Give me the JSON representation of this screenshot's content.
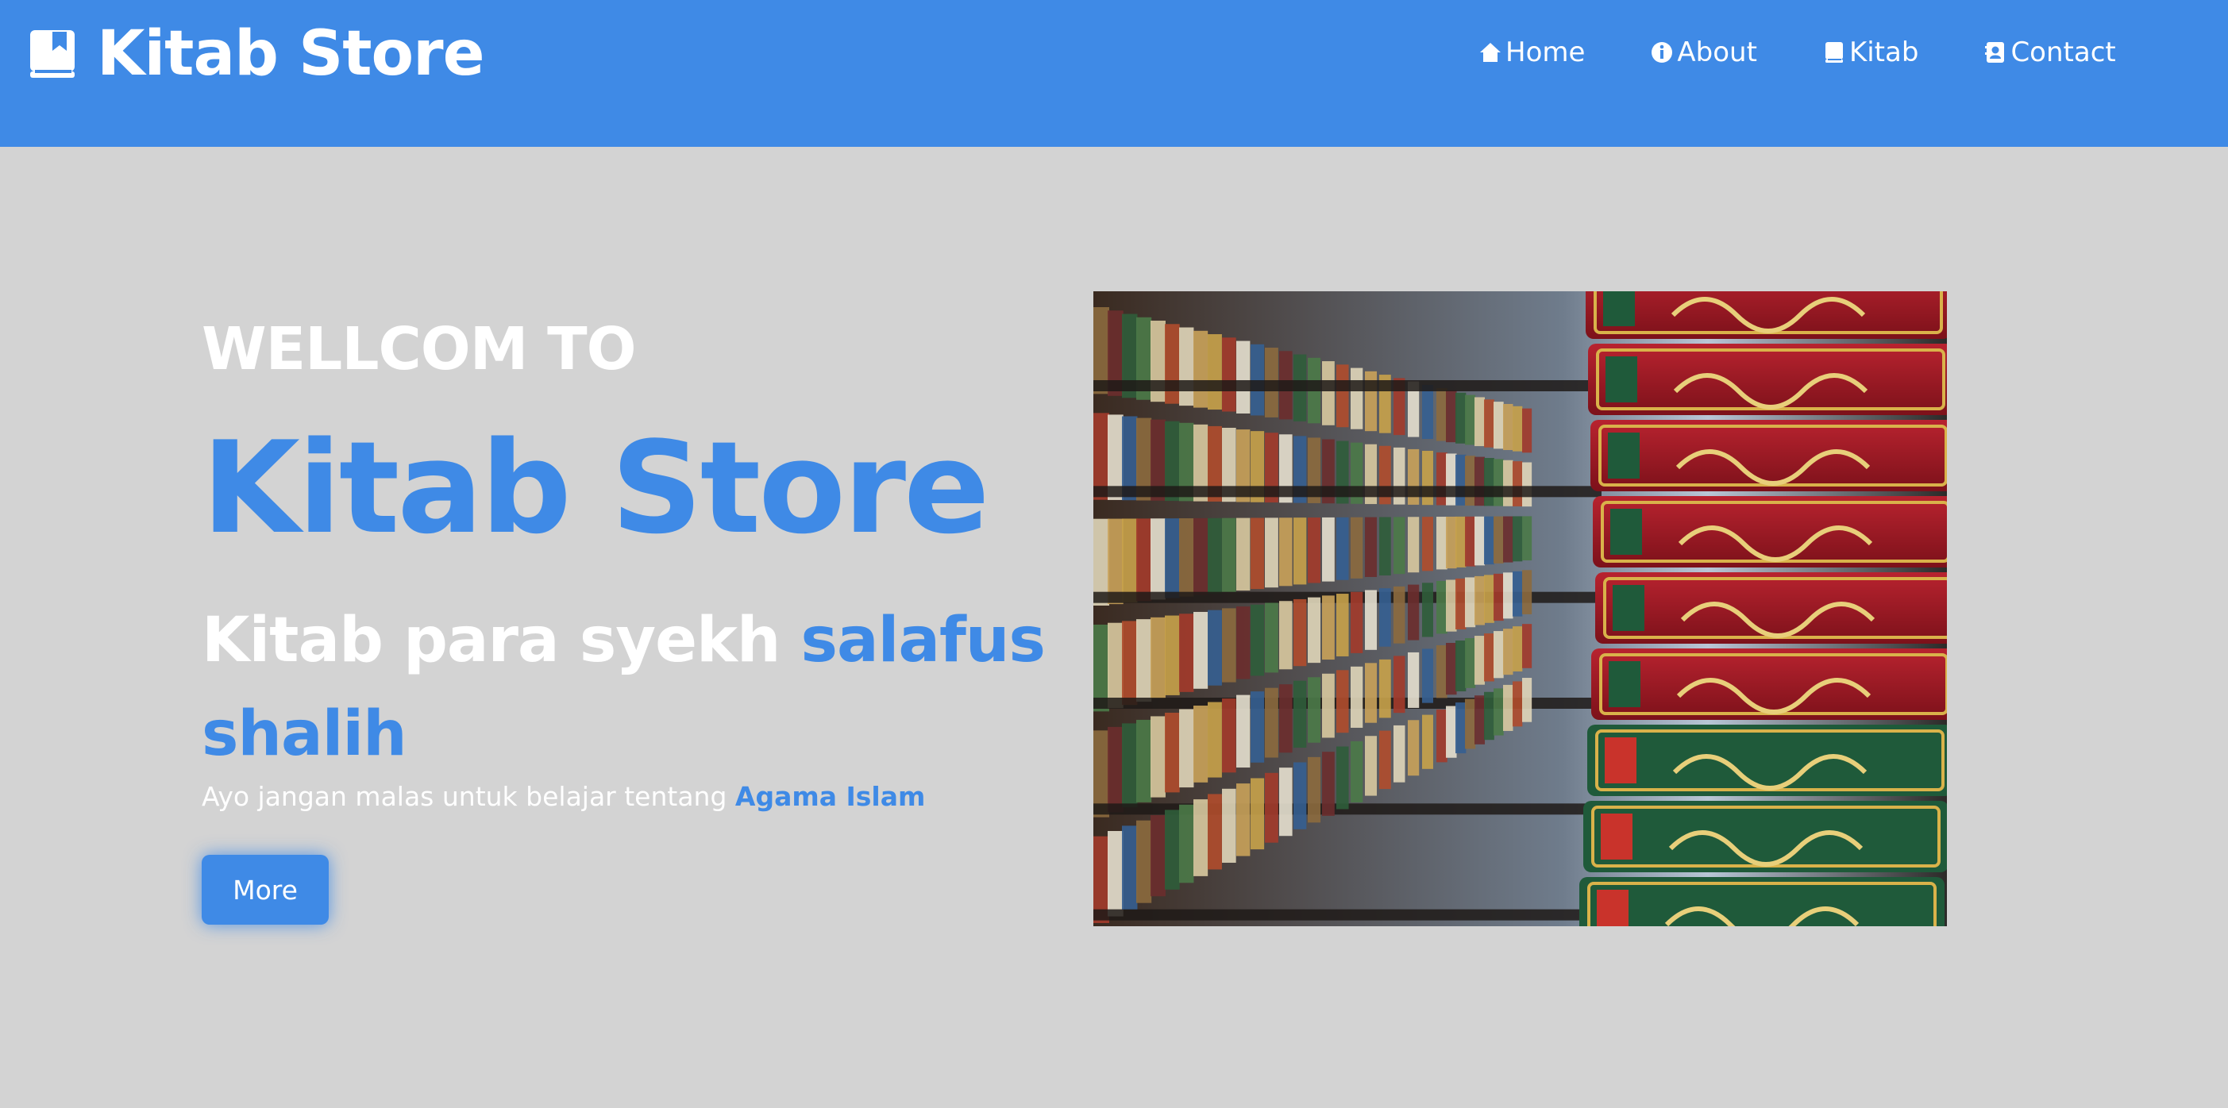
{
  "brand": {
    "icon": "book-icon",
    "name": "Kitab Store"
  },
  "nav": {
    "items": [
      {
        "icon": "home-icon",
        "label": "Home"
      },
      {
        "icon": "info-icon",
        "label": "About"
      },
      {
        "icon": "book-icon",
        "label": "Kitab"
      },
      {
        "icon": "contact-icon",
        "label": "Contact"
      }
    ]
  },
  "hero": {
    "welcome": "WELLCOM TO",
    "title": "Kitab Store",
    "tagline_part1": "Kitab para syekh ",
    "tagline_accent": "salafus shalih",
    "subline_part1": "Ayo jangan malas untuk belajar tentang ",
    "subline_accent": "Agama Islam",
    "button_label": "More"
  },
  "colors": {
    "accent": "#3f8ae6",
    "background": "#d3d3d3",
    "text_light": "#ffffff"
  }
}
